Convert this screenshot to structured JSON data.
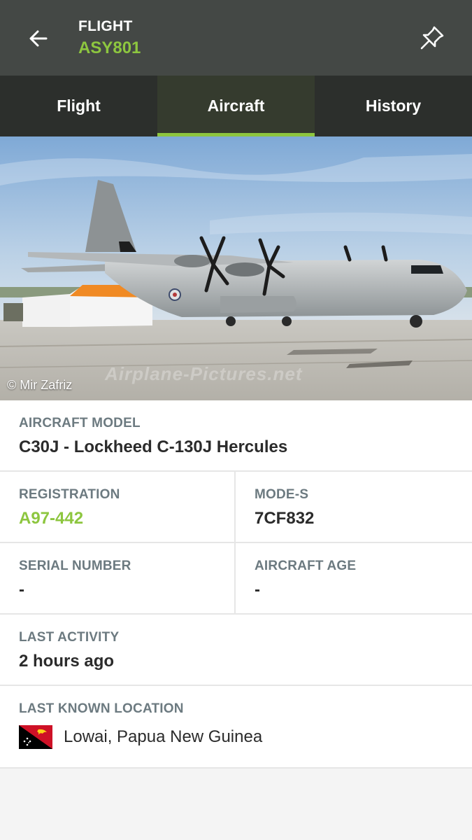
{
  "header": {
    "kicker": "FLIGHT",
    "callsign": "ASY801",
    "icons": {
      "back": "arrow-left-icon",
      "pin": "pin-icon"
    }
  },
  "tabs": [
    {
      "label": "Flight",
      "active": false
    },
    {
      "label": "Aircraft",
      "active": true
    },
    {
      "label": "History",
      "active": false
    }
  ],
  "photo": {
    "credit": "© Mir Zafriz",
    "watermark": "Airplane-Pictures.net"
  },
  "details": {
    "model": {
      "label": "AIRCRAFT MODEL",
      "value": "C30J - Lockheed C-130J Hercules"
    },
    "registration": {
      "label": "REGISTRATION",
      "value": "A97-442"
    },
    "modes": {
      "label": "MODE-S",
      "value": "7CF832"
    },
    "serial": {
      "label": "SERIAL NUMBER",
      "value": "-"
    },
    "age": {
      "label": "AIRCRAFT AGE",
      "value": "-"
    },
    "activity": {
      "label": "LAST ACTIVITY",
      "value": "2 hours ago"
    },
    "location": {
      "label": "LAST KNOWN LOCATION",
      "value": "Lowai, Papua New Guinea",
      "flag": "papua-new-guinea-flag"
    }
  },
  "colors": {
    "accent": "#8dc63f",
    "header": "#444845",
    "tabbar": "#2c2f2c"
  }
}
